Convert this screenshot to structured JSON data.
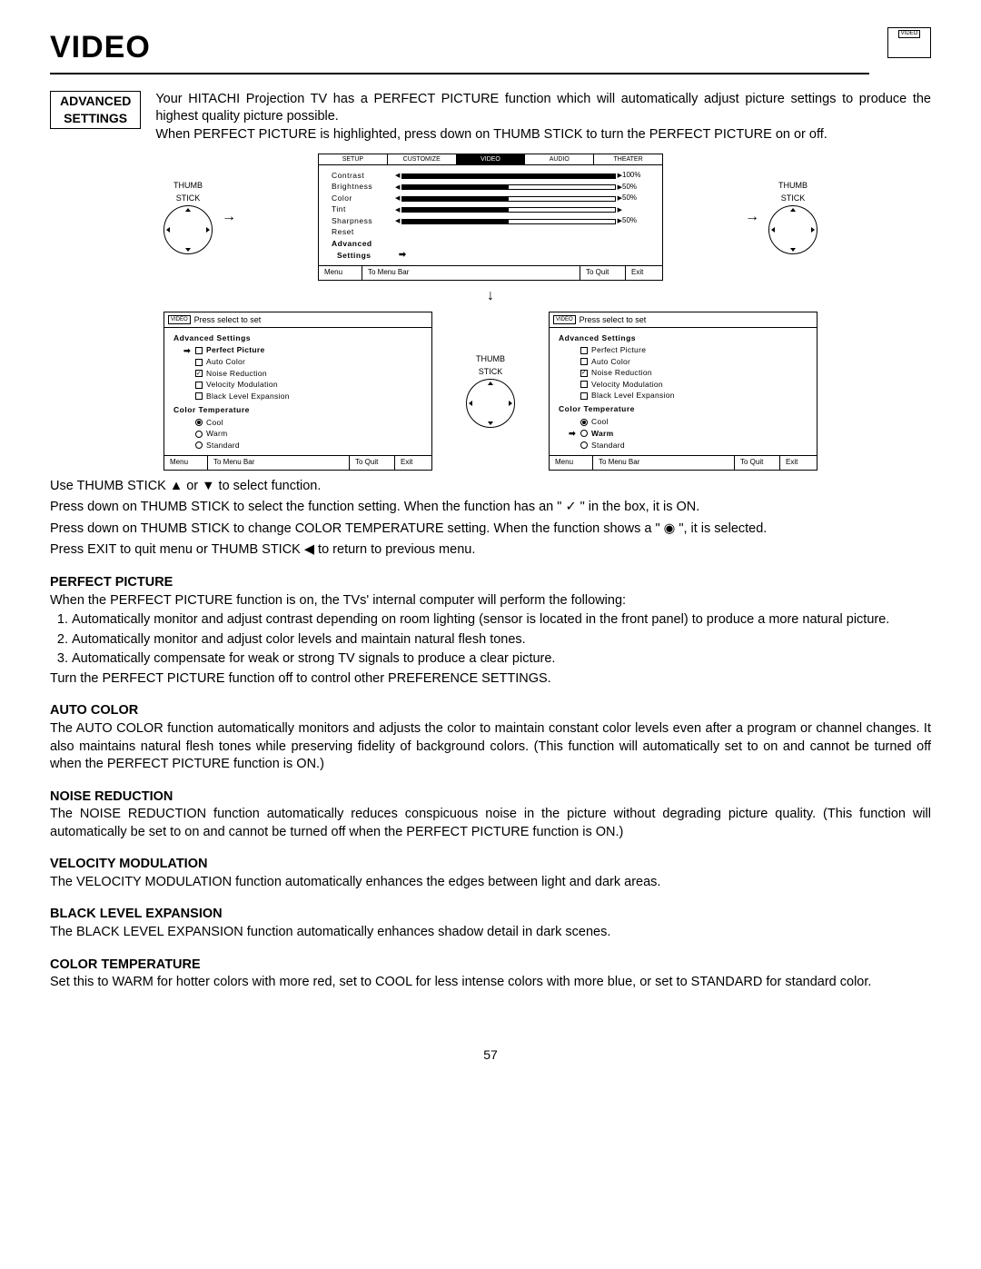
{
  "page_title": "VIDEO",
  "mini_icon": "VIDEO",
  "box_label_l1": "ADVANCED",
  "box_label_l2": "SETTINGS",
  "intro_p1": "Your HITACHI Projection TV has a PERFECT PICTURE function which will automatically adjust picture settings to produce the highest quality picture possible.",
  "intro_p2": "When PERFECT PICTURE is highlighted, press down on THUMB STICK to turn the PERFECT PICTURE on or off.",
  "thumb_label_1": "THUMB",
  "thumb_label_2": "STICK",
  "menu_tabs": [
    "SETUP",
    "CUSTOMIZE",
    "VIDEO",
    "AUDIO",
    "THEATER"
  ],
  "menu_rows": [
    {
      "label": "Contrast",
      "val": "100%"
    },
    {
      "label": "Brightness",
      "val": "50%"
    },
    {
      "label": "Color",
      "val": "50%"
    },
    {
      "label": "Tint",
      "val": ""
    },
    {
      "label": "Sharpness",
      "val": "50%"
    },
    {
      "label": "Reset",
      "val": ""
    }
  ],
  "menu_adv_l1": "Advanced",
  "menu_adv_l2": "Settings",
  "footer_menu": "Menu",
  "footer_bar": "To Menu Bar",
  "footer_quit": "To Quit",
  "footer_exit": "Exit",
  "adv_hdr_icon": "VIDEO",
  "adv_hdr_txt": "Press select to set",
  "adv_grp1": "Advanced Settings",
  "adv_items": [
    {
      "label": "Perfect Picture"
    },
    {
      "label": "Auto Color"
    },
    {
      "label": "Noise Reduction"
    },
    {
      "label": "Velocity Modulation"
    },
    {
      "label": "Black Level Expansion"
    }
  ],
  "adv_grp2": "Color Temperature",
  "adv_ct": [
    {
      "label": "Cool"
    },
    {
      "label": "Warm"
    },
    {
      "label": "Standard"
    }
  ],
  "instr_1": "Use THUMB STICK ▲ or ▼ to select function.",
  "instr_2": "Press down on THUMB STICK to select the function setting. When the function has an \" ✓ \" in the box, it is ON.",
  "instr_3": "Press down on THUMB STICK to change COLOR TEMPERATURE setting.  When the function shows a \" ◉ \", it is selected.",
  "instr_4": "Press EXIT to quit menu or THUMB STICK ◀ to return to previous menu.",
  "pp_h": "PERFECT PICTURE",
  "pp_intro": "When the PERFECT PICTURE function is on, the TVs' internal computer will perform the following:",
  "pp_1": "Automatically monitor and adjust contrast depending on room lighting (sensor is located in the front panel) to produce a more natural picture.",
  "pp_2": "Automatically monitor and adjust color levels and maintain natural flesh tones.",
  "pp_3": "Automatically compensate for weak or strong TV signals to produce a clear picture.",
  "pp_end": "Turn the PERFECT PICTURE function off to control other PREFERENCE SETTINGS.",
  "ac_h": "AUTO COLOR",
  "ac_p": "The AUTO COLOR function automatically monitors and adjusts the color to maintain constant color levels even after a program or channel changes. It also maintains natural flesh tones while preserving fidelity of background colors. (This function will automatically set to on and cannot be turned off when the PERFECT PICTURE function is ON.)",
  "nr_h": "NOISE REDUCTION",
  "nr_p": "The NOISE REDUCTION function automatically reduces conspicuous noise in the picture without degrading picture quality. (This function will automatically be set to on and cannot be turned off when the PERFECT PICTURE function is ON.)",
  "vm_h": "VELOCITY MODULATION",
  "vm_p": "The VELOCITY MODULATION function automatically enhances the edges between light and dark areas.",
  "ble_h": "BLACK LEVEL EXPANSION",
  "ble_p": "The BLACK LEVEL EXPANSION function automatically enhances shadow detail in dark scenes.",
  "ct_h": "COLOR TEMPERATURE",
  "ct_p": "Set this to WARM for hotter colors with more red, set to COOL for less intense colors with more blue, or set to STANDARD for standard color.",
  "page_num": "57"
}
